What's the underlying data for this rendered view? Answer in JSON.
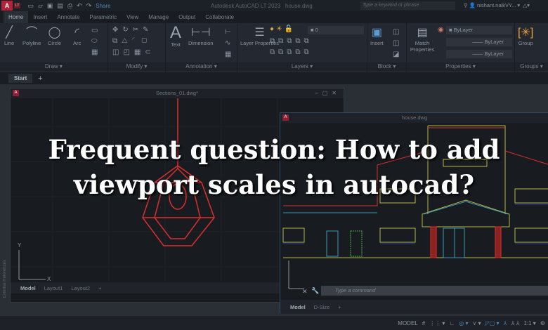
{
  "titlebar": {
    "logo": "A",
    "badge": "LT",
    "share": "Share",
    "app_title": "Autodesk AutoCAD LT 2023",
    "file": "house.dwg",
    "search_placeholder": "Type a keyword or phrase",
    "user": "nishant.naikVY..."
  },
  "ribbon_tabs": [
    "Home",
    "Insert",
    "Annotate",
    "Parametric",
    "View",
    "Manage",
    "Output",
    "Collaborate"
  ],
  "panels": {
    "draw": {
      "label": "Draw",
      "tools": [
        "Line",
        "Polyline",
        "Circle",
        "Arc"
      ]
    },
    "modify": {
      "label": "Modify"
    },
    "annotation": {
      "label": "Annotation",
      "tools": [
        "Text",
        "Dimension"
      ]
    },
    "layers": {
      "label": "Layers",
      "tool": "Layer Properties",
      "layer_value": "0"
    },
    "block": {
      "label": "Block",
      "tool": "Insert"
    },
    "properties": {
      "label": "Properties",
      "tool": "Match Properties",
      "color": "ByLayer",
      "linetype": "ByLayer",
      "lineweight": "ByLayer"
    },
    "groups": {
      "label": "Groups",
      "tool": "Group"
    }
  },
  "file_tabs": {
    "start": "Start",
    "add": "+"
  },
  "window1": {
    "title": "Sections_01.dwg*",
    "tabs": [
      "Model",
      "Layout1",
      "Layout2"
    ],
    "side_label": "External References"
  },
  "window2": {
    "title": "house.dwg",
    "tabs": [
      "Model",
      "D-Size"
    ],
    "command_placeholder": "Type a command"
  },
  "statusbar": {
    "model": "MODEL",
    "scale": "1:1"
  },
  "headline": {
    "line1": "Frequent question: How to add",
    "line2": "viewport scales in autocad?"
  },
  "colors": {
    "accent": "#b3233a",
    "drawing_red": "#d8302c",
    "drawing_yellow": "#b9b64a",
    "drawing_cyan": "#3d9ab5",
    "drawing_green": "#3fb33a"
  }
}
